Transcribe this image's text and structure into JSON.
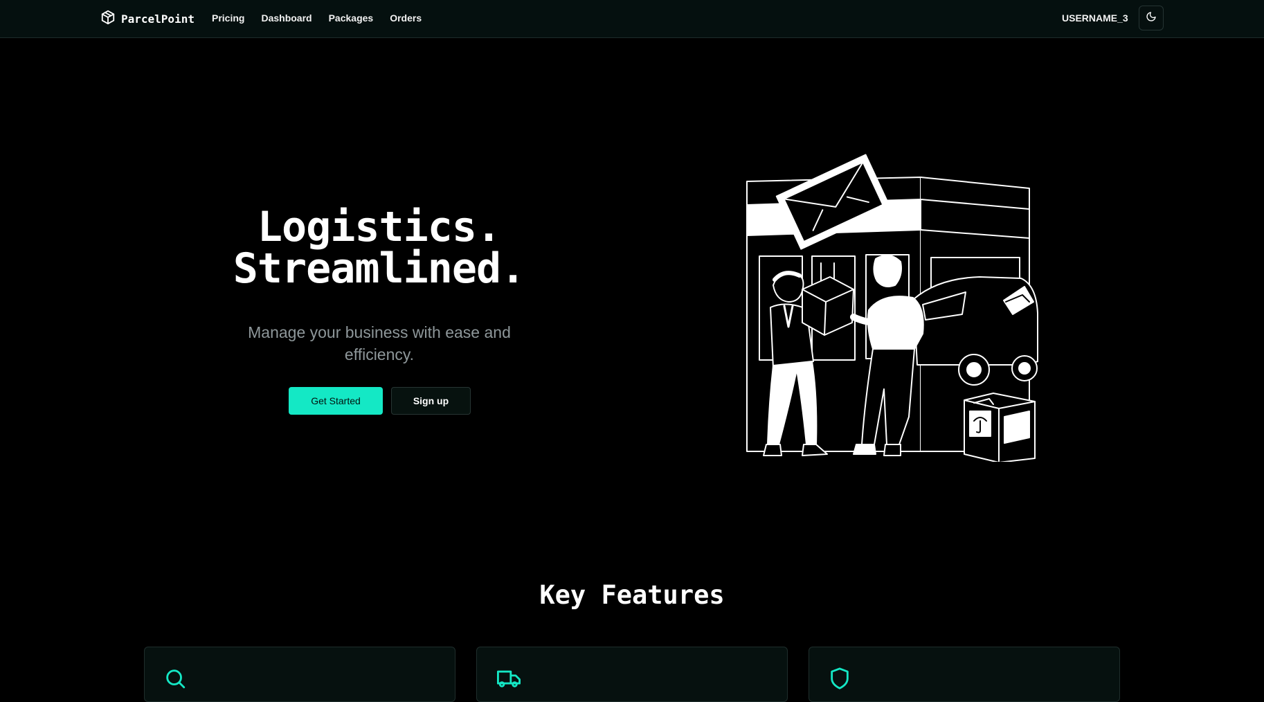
{
  "navbar": {
    "brand": "ParcelPoint",
    "links": [
      "Pricing",
      "Dashboard",
      "Packages",
      "Orders"
    ],
    "username": "USERNAME_3",
    "theme_icon": "moon-icon"
  },
  "hero": {
    "title_line1": "Logistics.",
    "title_line2": "Streamlined.",
    "subtitle": "Manage your business with ease and efficiency.",
    "primary_button": "Get Started",
    "secondary_button": "Sign up",
    "illustration": "delivery-handoff-illustration"
  },
  "features": {
    "title": "Key Features",
    "cards": [
      {
        "icon": "search-icon"
      },
      {
        "icon": "truck-icon"
      },
      {
        "icon": "shield-icon"
      }
    ]
  },
  "colors": {
    "accent": "#14e8c5",
    "background": "#000000",
    "navbar": "#05100f",
    "muted_text": "#8e979a"
  }
}
